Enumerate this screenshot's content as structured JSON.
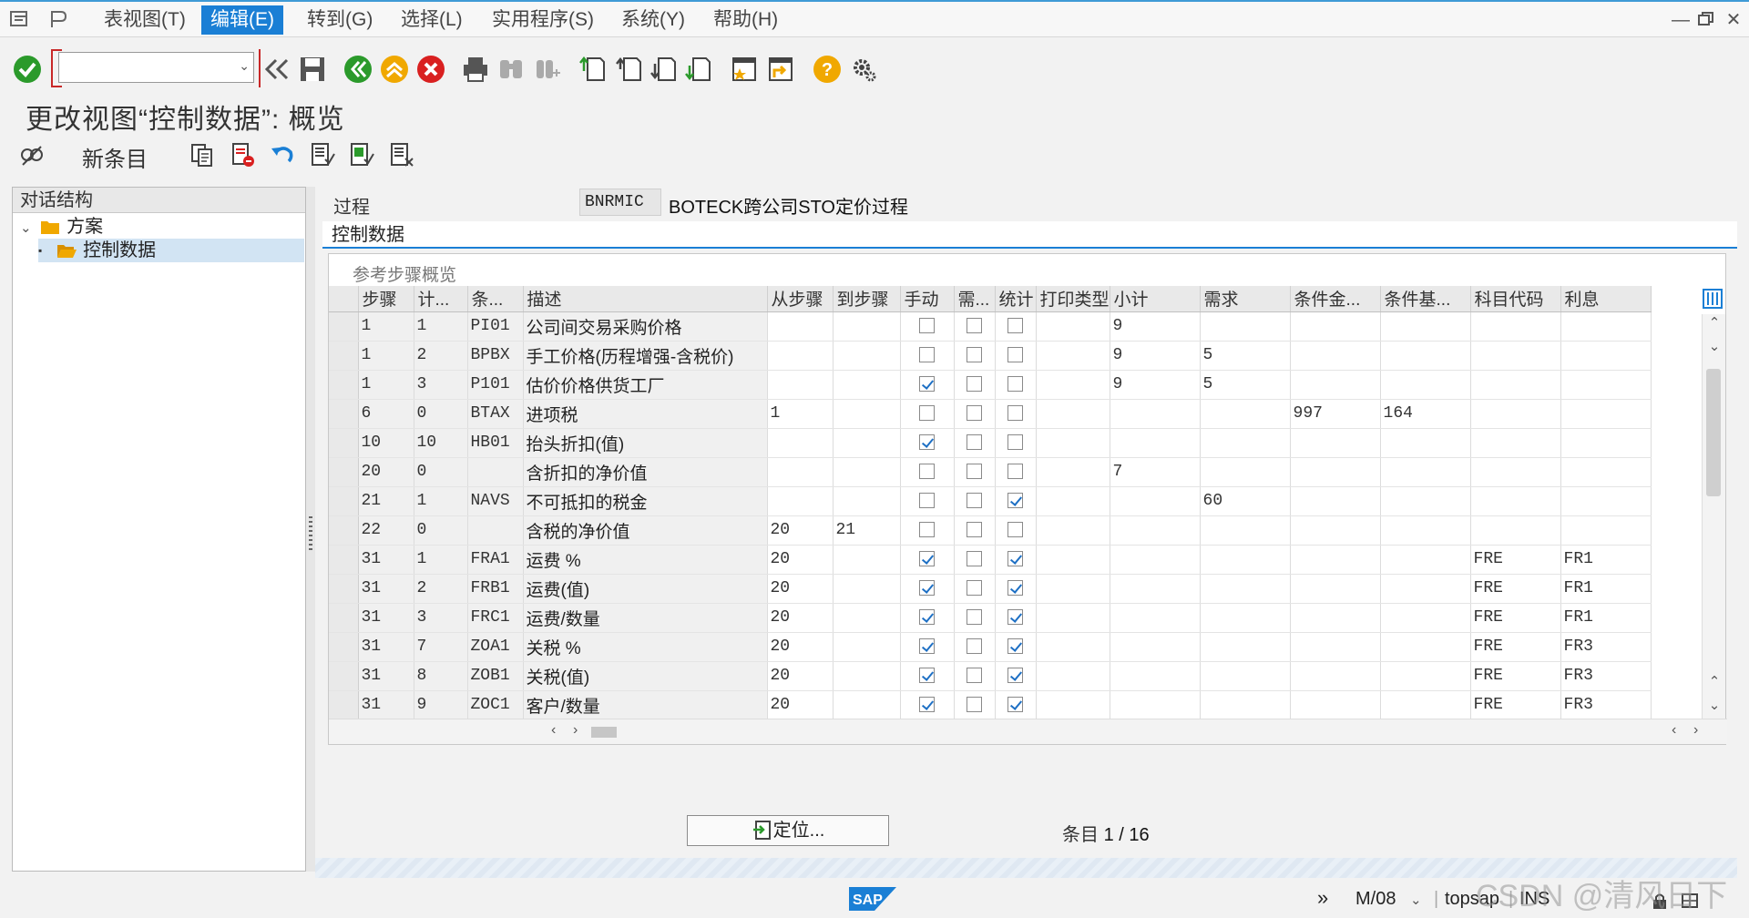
{
  "menubar": {
    "items": [
      "表视图(T)",
      "编辑(E)",
      "转到(G)",
      "选择(L)",
      "实用程序(S)",
      "系统(Y)",
      "帮助(H)"
    ],
    "active_index": 1
  },
  "toolbar": {
    "command_value": ""
  },
  "page": {
    "title": "更改视图“控制数据”: 概览"
  },
  "app_toolbar": {
    "new_entries_label": "新条目"
  },
  "tree": {
    "header": "对话结构",
    "nodes": [
      {
        "label": "方案",
        "level": 0,
        "expanded": true
      },
      {
        "label": "控制数据",
        "level": 1,
        "selected": true
      }
    ]
  },
  "procedure": {
    "label": "过程",
    "code": "BNRMIC",
    "description": "BOTECK跨公司STO定价过程"
  },
  "section": {
    "title": "控制数据"
  },
  "table": {
    "title": "参考步骤概览",
    "columns": [
      "步骤",
      "计...",
      "条...",
      "描述",
      "从步骤",
      "到步骤",
      "手动",
      "需...",
      "统计",
      "打印类型",
      "小计",
      "需求",
      "条件金...",
      "条件基...",
      "科目代码",
      "利息"
    ],
    "rows": [
      {
        "step": "1",
        "counter": "1",
        "ctype": "PI01",
        "desc": "公司间交易采购价格",
        "from": "",
        "to": "",
        "manual": false,
        "required": false,
        "statistical": false,
        "print": "",
        "subtotal": "9",
        "requirement": "",
        "altcalc": "",
        "altbase": "",
        "acctkey": "",
        "accrual": ""
      },
      {
        "step": "1",
        "counter": "2",
        "ctype": "BPBX",
        "desc": "手工价格(历程增强-含税价)",
        "from": "",
        "to": "",
        "manual": false,
        "required": false,
        "statistical": false,
        "print": "",
        "subtotal": "9",
        "requirement": "5",
        "altcalc": "",
        "altbase": "",
        "acctkey": "",
        "accrual": ""
      },
      {
        "step": "1",
        "counter": "3",
        "ctype": "P101",
        "desc": "估价价格供货工厂",
        "from": "",
        "to": "",
        "manual": true,
        "required": false,
        "statistical": false,
        "print": "",
        "subtotal": "9",
        "requirement": "5",
        "altcalc": "",
        "altbase": "",
        "acctkey": "",
        "accrual": ""
      },
      {
        "step": "6",
        "counter": "0",
        "ctype": "BTAX",
        "desc": "进项税",
        "from": "1",
        "to": "",
        "manual": false,
        "required": false,
        "statistical": false,
        "print": "",
        "subtotal": "",
        "requirement": "",
        "altcalc": "997",
        "altbase": "164",
        "acctkey": "",
        "accrual": ""
      },
      {
        "step": "10",
        "counter": "10",
        "ctype": "HB01",
        "desc": "抬头折扣(值)",
        "from": "",
        "to": "",
        "manual": true,
        "required": false,
        "statistical": false,
        "print": "",
        "subtotal": "",
        "requirement": "",
        "altcalc": "",
        "altbase": "",
        "acctkey": "",
        "accrual": ""
      },
      {
        "step": "20",
        "counter": "0",
        "ctype": "",
        "desc": "含折扣的净价值",
        "from": "",
        "to": "",
        "manual": false,
        "required": false,
        "statistical": false,
        "print": "",
        "subtotal": "7",
        "requirement": "",
        "altcalc": "",
        "altbase": "",
        "acctkey": "",
        "accrual": ""
      },
      {
        "step": "21",
        "counter": "1",
        "ctype": "NAVS",
        "desc": "不可抵扣的税金",
        "from": "",
        "to": "",
        "manual": false,
        "required": false,
        "statistical": true,
        "print": "",
        "subtotal": "",
        "requirement": "60",
        "altcalc": "",
        "altbase": "",
        "acctkey": "",
        "accrual": ""
      },
      {
        "step": "22",
        "counter": "0",
        "ctype": "",
        "desc": "含税的净价值",
        "from": "20",
        "to": "21",
        "manual": false,
        "required": false,
        "statistical": false,
        "print": "",
        "subtotal": "",
        "requirement": "",
        "altcalc": "",
        "altbase": "",
        "acctkey": "",
        "accrual": ""
      },
      {
        "step": "31",
        "counter": "1",
        "ctype": "FRA1",
        "desc": "运费 %",
        "from": "20",
        "to": "",
        "manual": true,
        "required": false,
        "statistical": true,
        "print": "",
        "subtotal": "",
        "requirement": "",
        "altcalc": "",
        "altbase": "",
        "acctkey": "FRE",
        "accrual": "FR1"
      },
      {
        "step": "31",
        "counter": "2",
        "ctype": "FRB1",
        "desc": "运费(值)",
        "from": "20",
        "to": "",
        "manual": true,
        "required": false,
        "statistical": true,
        "print": "",
        "subtotal": "",
        "requirement": "",
        "altcalc": "",
        "altbase": "",
        "acctkey": "FRE",
        "accrual": "FR1"
      },
      {
        "step": "31",
        "counter": "3",
        "ctype": "FRC1",
        "desc": "运费/数量",
        "from": "20",
        "to": "",
        "manual": true,
        "required": false,
        "statistical": true,
        "print": "",
        "subtotal": "",
        "requirement": "",
        "altcalc": "",
        "altbase": "",
        "acctkey": "FRE",
        "accrual": "FR1"
      },
      {
        "step": "31",
        "counter": "7",
        "ctype": "ZOA1",
        "desc": "关税 %",
        "from": "20",
        "to": "",
        "manual": true,
        "required": false,
        "statistical": true,
        "print": "",
        "subtotal": "",
        "requirement": "",
        "altcalc": "",
        "altbase": "",
        "acctkey": "FRE",
        "accrual": "FR3"
      },
      {
        "step": "31",
        "counter": "8",
        "ctype": "ZOB1",
        "desc": "关税(值)",
        "from": "20",
        "to": "",
        "manual": true,
        "required": false,
        "statistical": true,
        "print": "",
        "subtotal": "",
        "requirement": "",
        "altcalc": "",
        "altbase": "",
        "acctkey": "FRE",
        "accrual": "FR3"
      },
      {
        "step": "31",
        "counter": "9",
        "ctype": "ZOC1",
        "desc": "客户/数量",
        "from": "20",
        "to": "",
        "manual": true,
        "required": false,
        "statistical": true,
        "print": "",
        "subtotal": "",
        "requirement": "",
        "altcalc": "",
        "altbase": "",
        "acctkey": "FRE",
        "accrual": "FR3"
      }
    ]
  },
  "position_button": {
    "label": "定位..."
  },
  "entry_info": {
    "label": "条目",
    "value": "1 / 16"
  },
  "statusbar": {
    "mode": "M/08",
    "server": "topsap",
    "ins": "INS"
  },
  "watermark": "CSDN @清风日下",
  "colors": {
    "accent": "#1a7fd5",
    "selected_menu": "#1a7fd5",
    "check_blue": "#1d6fc4"
  }
}
